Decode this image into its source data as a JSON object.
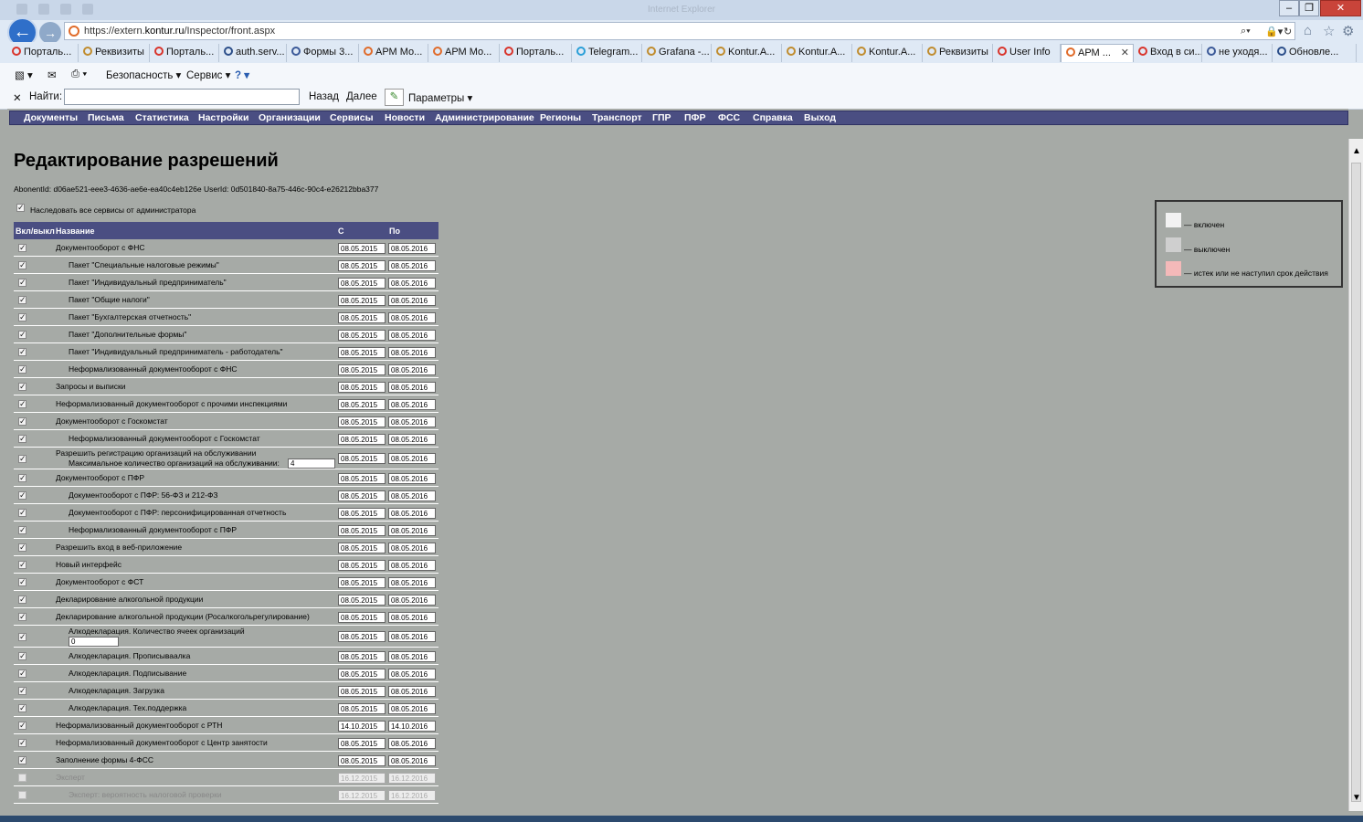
{
  "browser": {
    "window_title": "Internet Explorer",
    "url_prefix": "https://extern.",
    "url_domain": "kontur.ru",
    "url_path": "/Inspector/front.aspx",
    "tabs": [
      {
        "label": "Порталь...",
        "icon": "portal-icon",
        "color": "#d9342b"
      },
      {
        "label": "Реквизиты",
        "icon": "ie-icon",
        "color": "#c08c2e"
      },
      {
        "label": "Порталь...",
        "icon": "portal-icon",
        "color": "#d9342b"
      },
      {
        "label": "auth.serv...",
        "icon": "cross-icon",
        "color": "#2c4f8a"
      },
      {
        "label": "Формы 3...",
        "icon": "page-icon",
        "color": "#3b5998"
      },
      {
        "label": "АРМ Мо...",
        "icon": "kontur-icon",
        "color": "#e06b2a"
      },
      {
        "label": "АРМ Мо...",
        "icon": "kontur-icon",
        "color": "#e06b2a"
      },
      {
        "label": "Порталь...",
        "icon": "portal-icon",
        "color": "#d9342b"
      },
      {
        "label": "Telegram...",
        "icon": "telegram-icon",
        "color": "#2a9fd8"
      },
      {
        "label": "Grafana -...",
        "icon": "ie-icon",
        "color": "#c08c2e"
      },
      {
        "label": "Kontur.A...",
        "icon": "ie-icon",
        "color": "#c08c2e"
      },
      {
        "label": "Kontur.A...",
        "icon": "ie-icon",
        "color": "#c08c2e"
      },
      {
        "label": "Kontur.A...",
        "icon": "ie-icon",
        "color": "#c08c2e"
      },
      {
        "label": "Реквизиты",
        "icon": "ie-icon",
        "color": "#c08c2e"
      },
      {
        "label": "User Info",
        "icon": "portal-icon",
        "color": "#d9342b"
      },
      {
        "label": "АРМ ...",
        "icon": "kontur-icon",
        "color": "#e06b2a",
        "active": true
      },
      {
        "label": "Вход в си...",
        "icon": "portal-icon",
        "color": "#d9342b"
      },
      {
        "label": "не уходя...",
        "icon": "page-icon",
        "color": "#3b5998"
      },
      {
        "label": "Обновле...",
        "icon": "cross-icon",
        "color": "#2c4f8a"
      }
    ],
    "commands": {
      "safety": "Безопасность",
      "tools": "Сервис"
    },
    "find": {
      "label": "Найти:",
      "value": "",
      "prev": "Назад",
      "next": "Далее",
      "options": "Параметры"
    }
  },
  "site_nav": [
    "Документы",
    "Письма",
    "Статистика",
    "Настройки",
    "Организации",
    "Сервисы",
    "Новости",
    "Администрирование",
    "Регионы",
    "Транспорт",
    "ГПР",
    "ПФР",
    "ФСС",
    "Справка",
    "Выход"
  ],
  "page": {
    "title": "Редактирование разрешений",
    "ids": "AbonentId: d06ae521-eee3-4636-ae6e-ea40c4eb126e UserId: 0d501840-8a75-446c-90c4-e26212bba377",
    "inherit_label": "Наследовать все сервисы от администратора",
    "inherit_checked": true
  },
  "table": {
    "headers": {
      "toggle": "Вкл/выкл",
      "name": "Название",
      "from": "С",
      "to": "По"
    },
    "rows": [
      {
        "name": "Документооборот с ФНС",
        "indent": 1,
        "from": "08.05.2015",
        "to": "08.05.2016",
        "checked": true
      },
      {
        "name": "Пакет \"Специальные налоговые режимы\"",
        "indent": 2,
        "from": "08.05.2015",
        "to": "08.05.2016",
        "checked": true
      },
      {
        "name": "Пакет \"Индивидуальный предприниматель\"",
        "indent": 2,
        "from": "08.05.2015",
        "to": "08.05.2016",
        "checked": true
      },
      {
        "name": "Пакет \"Общие налоги\"",
        "indent": 2,
        "from": "08.05.2015",
        "to": "08.05.2016",
        "checked": true
      },
      {
        "name": "Пакет \"Бухгалтерская отчетность\"",
        "indent": 2,
        "from": "08.05.2015",
        "to": "08.05.2016",
        "checked": true
      },
      {
        "name": "Пакет \"Дополнительные формы\"",
        "indent": 2,
        "from": "08.05.2015",
        "to": "08.05.2016",
        "checked": true
      },
      {
        "name": "Пакет \"Индивидуальный предприниматель - работодатель\"",
        "indent": 2,
        "from": "08.05.2015",
        "to": "08.05.2016",
        "checked": true
      },
      {
        "name": "Неформализованный документооборот с ФНС",
        "indent": 2,
        "from": "08.05.2015",
        "to": "08.05.2016",
        "checked": true
      },
      {
        "name": "Запросы и выписки",
        "indent": 1,
        "from": "08.05.2015",
        "to": "08.05.2016",
        "checked": true
      },
      {
        "name": "Неформализованный документооборот с прочими инспекциями",
        "indent": 1,
        "from": "08.05.2015",
        "to": "08.05.2016",
        "checked": true
      },
      {
        "name": "Документооборот с Госкомстат",
        "indent": 1,
        "from": "08.05.2015",
        "to": "08.05.2016",
        "checked": true
      },
      {
        "name": "Неформализованный документооборот с Госкомстат",
        "indent": 2,
        "from": "08.05.2015",
        "to": "08.05.2016",
        "checked": true
      },
      {
        "name": "Разрешить регистрацию организаций на обслуживании",
        "indent": 1,
        "from": "08.05.2015",
        "to": "08.05.2016",
        "checked": true,
        "sub_label": "Максимальное количество организаций на обслуживании:",
        "sub_value": "4"
      },
      {
        "name": "Документооборот с ПФР",
        "indent": 1,
        "from": "08.05.2015",
        "to": "08.05.2016",
        "checked": true
      },
      {
        "name": "Документооборот с ПФР: 56-ФЗ и 212-ФЗ",
        "indent": 2,
        "from": "08.05.2015",
        "to": "08.05.2016",
        "checked": true
      },
      {
        "name": "Документооборот с ПФР: персонифицированная отчетность",
        "indent": 2,
        "from": "08.05.2015",
        "to": "08.05.2016",
        "checked": true
      },
      {
        "name": "Неформализованный документооборот с ПФР",
        "indent": 2,
        "from": "08.05.2015",
        "to": "08.05.2016",
        "checked": true
      },
      {
        "name": "Разрешить вход в веб-приложение",
        "indent": 1,
        "from": "08.05.2015",
        "to": "08.05.2016",
        "checked": true
      },
      {
        "name": "Новый интерфейс",
        "indent": 1,
        "from": "08.05.2015",
        "to": "08.05.2016",
        "checked": true
      },
      {
        "name": "Документооборот с ФСТ",
        "indent": 1,
        "from": "08.05.2015",
        "to": "08.05.2016",
        "checked": true
      },
      {
        "name": "Декларирование алкогольной продукции",
        "indent": 1,
        "from": "08.05.2015",
        "to": "08.05.2016",
        "checked": true
      },
      {
        "name": "Декларирование алкогольной продукции (Росалкогольрегулирование)",
        "indent": 1,
        "from": "08.05.2015",
        "to": "08.05.2016",
        "checked": true
      },
      {
        "name": "Алкодекларация. Количество ячеек организаций",
        "indent": 2,
        "from": "08.05.2015",
        "to": "08.05.2016",
        "checked": true,
        "sub_value": "0"
      },
      {
        "name": "Алкодекларация. Прописываалка",
        "indent": 2,
        "from": "08.05.2015",
        "to": "08.05.2016",
        "checked": true
      },
      {
        "name": "Алкодекларация. Подписывание",
        "indent": 2,
        "from": "08.05.2015",
        "to": "08.05.2016",
        "checked": true
      },
      {
        "name": "Алкодекларация. Загрузка",
        "indent": 2,
        "from": "08.05.2015",
        "to": "08.05.2016",
        "checked": true
      },
      {
        "name": "Алкодекларация. Тех.поддержка",
        "indent": 2,
        "from": "08.05.2015",
        "to": "08.05.2016",
        "checked": true
      },
      {
        "name": "Неформализованный документооборот с РТН",
        "indent": 1,
        "from": "14.10.2015",
        "to": "14.10.2016",
        "checked": true
      },
      {
        "name": "Неформализованный документооборот с Центр занятости",
        "indent": 1,
        "from": "08.05.2015",
        "to": "08.05.2016",
        "checked": true
      },
      {
        "name": "Заполнение формы 4-ФСС",
        "indent": 1,
        "from": "08.05.2015",
        "to": "08.05.2016",
        "checked": true
      },
      {
        "name": "Эксперт",
        "indent": 1,
        "from": "16.12.2015",
        "to": "16.12.2016",
        "checked": false,
        "disabled": true
      },
      {
        "name": "Эксперт: вероятность налоговой проверки",
        "indent": 2,
        "from": "16.12.2015",
        "to": "16.12.2016",
        "checked": false,
        "disabled": true
      }
    ]
  },
  "legend": [
    {
      "label": "— включен",
      "color": "#f2f2f2"
    },
    {
      "label": "— выключен",
      "color": "#cfcfcf"
    },
    {
      "label": "— истек или не наступил срок действия",
      "color": "#f4b9b9"
    }
  ]
}
